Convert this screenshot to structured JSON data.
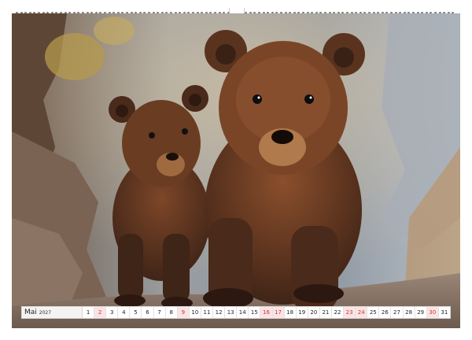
{
  "calendar": {
    "month": "Mai",
    "year": "2027",
    "days": [
      {
        "n": "1"
      },
      {
        "n": "2",
        "sun": true
      },
      {
        "n": "3"
      },
      {
        "n": "4"
      },
      {
        "n": "5"
      },
      {
        "n": "6"
      },
      {
        "n": "7"
      },
      {
        "n": "8"
      },
      {
        "n": "9",
        "sun": true
      },
      {
        "n": "10"
      },
      {
        "n": "11"
      },
      {
        "n": "12"
      },
      {
        "n": "13"
      },
      {
        "n": "14"
      },
      {
        "n": "15"
      },
      {
        "n": "16",
        "sun": true
      },
      {
        "n": "17",
        "sun": true
      },
      {
        "n": "18"
      },
      {
        "n": "19"
      },
      {
        "n": "20"
      },
      {
        "n": "21"
      },
      {
        "n": "22"
      },
      {
        "n": "23",
        "sun": true
      },
      {
        "n": "24",
        "sun": true
      },
      {
        "n": "25"
      },
      {
        "n": "26"
      },
      {
        "n": "27"
      },
      {
        "n": "28"
      },
      {
        "n": "29"
      },
      {
        "n": "30",
        "sun": true
      },
      {
        "n": "31"
      }
    ]
  },
  "colors": {
    "sunday_bg": "#fbe3e4",
    "sunday_text": "#c23b3b",
    "bear_fur": "#5a3320",
    "bear_highlight": "#a8673a"
  }
}
